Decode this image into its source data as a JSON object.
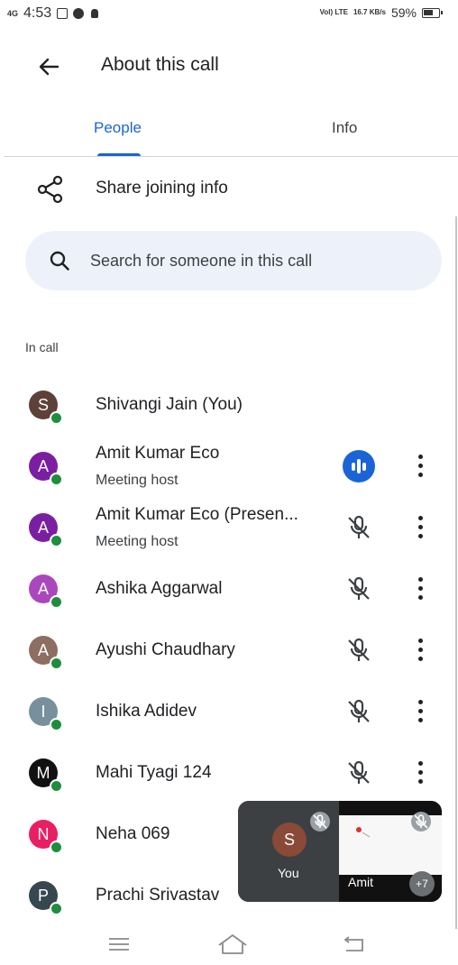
{
  "status_bar": {
    "network": "4G",
    "time": "4:53",
    "volte": "Vol) LTE",
    "speed": "16.7 KB/s",
    "battery": "59%"
  },
  "header": {
    "title": "About this call"
  },
  "tabs": [
    {
      "label": "People",
      "active": true
    },
    {
      "label": "Info",
      "active": false
    }
  ],
  "share": {
    "label": "Share joining info"
  },
  "search": {
    "placeholder": "Search for someone in this call"
  },
  "section": {
    "label": "In call"
  },
  "participants": [
    {
      "initial": "S",
      "name": "Shivangi Jain (You)",
      "role": "",
      "avatar_color": "#5d4037",
      "mic": "none"
    },
    {
      "initial": "A",
      "name": "Amit Kumar Eco",
      "role": "Meeting host",
      "avatar_color": "#7b1fa2",
      "mic": "speaking"
    },
    {
      "initial": "A",
      "name": "Amit Kumar Eco (Presen...",
      "role": "Meeting host",
      "avatar_color": "#7b1fa2",
      "mic": "muted"
    },
    {
      "initial": "A",
      "name": "Ashika Aggarwal",
      "role": "",
      "avatar_color": "#ab47bc",
      "mic": "muted"
    },
    {
      "initial": "A",
      "name": "Ayushi Chaudhary",
      "role": "",
      "avatar_color": "#8d6e63",
      "mic": "muted"
    },
    {
      "initial": "I",
      "name": "Ishika Adidev",
      "role": "",
      "avatar_color": "#78909c",
      "mic": "muted"
    },
    {
      "initial": "M",
      "name": "Mahi Tyagi 124",
      "role": "",
      "avatar_color": "#111111",
      "mic": "muted"
    },
    {
      "initial": "N",
      "name": "Neha 069",
      "role": "",
      "avatar_color": "#e91e63",
      "mic": "none"
    },
    {
      "initial": "P",
      "name": "Prachi Srivastav",
      "role": "",
      "avatar_color": "#37474f",
      "mic": "none"
    }
  ],
  "pip": {
    "you_initial": "S",
    "you_label": "You",
    "other_label": "Amit",
    "more_count": "+7"
  },
  "colors": {
    "accent": "#1a64d6",
    "online": "#1e8e3e",
    "search_bg": "#edf2fa"
  }
}
